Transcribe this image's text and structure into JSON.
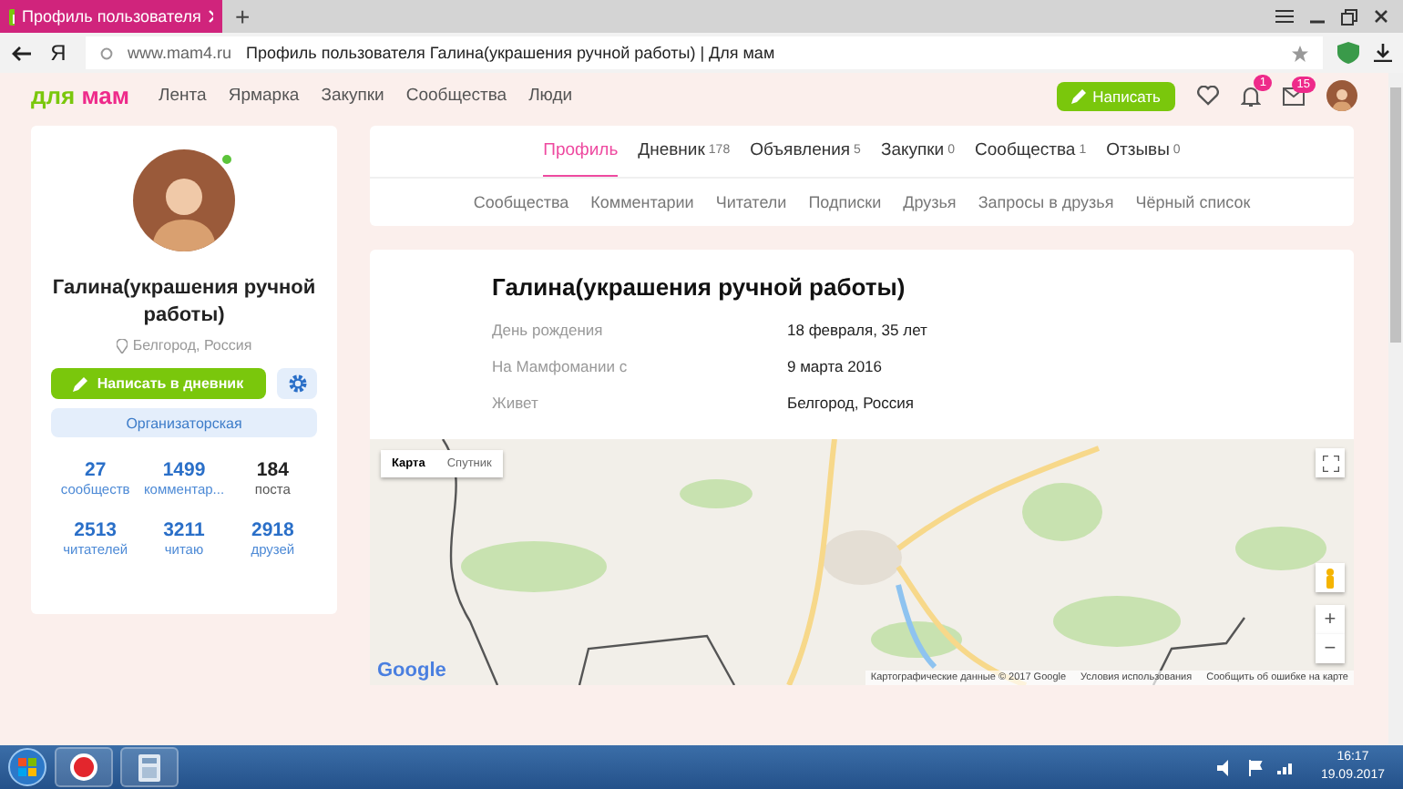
{
  "browser": {
    "tab_title": "Профиль пользователя",
    "new_tab": "+",
    "yandex_key": "Я",
    "url": "www.mam4.ru",
    "page_title": "Профиль пользователя Галина(украшения ручной работы) | Для мам"
  },
  "header": {
    "logo": {
      "first": "для",
      "second": "мам"
    },
    "nav": [
      "Лента",
      "Ярмарка",
      "Закупки",
      "Сообщества",
      "Люди"
    ],
    "write_button": "Написать",
    "notifications": "1",
    "messages": "15"
  },
  "profile": {
    "online": true,
    "name": "Галина(украшения ручной работы)",
    "location": "Белгород, Россия",
    "diary_button": "Написать в дневник",
    "role": "Организаторская",
    "stats": [
      {
        "value": "27",
        "label": "сообществ",
        "kind": "link"
      },
      {
        "value": "1499",
        "label": "комментар...",
        "kind": "link"
      },
      {
        "value": "184",
        "label": "поста",
        "kind": "plain"
      },
      {
        "value": "2513",
        "label": "читателей",
        "kind": "link"
      },
      {
        "value": "3211",
        "label": "читаю",
        "kind": "link"
      },
      {
        "value": "2918",
        "label": "друзей",
        "kind": "link"
      }
    ]
  },
  "tabs": [
    {
      "label": "Профиль",
      "selected": true
    },
    {
      "label": "Дневник",
      "count": "178",
      "selected": false
    },
    {
      "label": "Объявления",
      "count": "5",
      "selected": false
    },
    {
      "label": "Закупки",
      "count": "0",
      "selected": false
    },
    {
      "label": "Сообщества",
      "count": "1",
      "selected": false
    },
    {
      "label": "Отзывы",
      "count": "0",
      "selected": false
    }
  ],
  "subtabs": [
    "Сообщества",
    "Комментарии",
    "Читатели",
    "Подписки",
    "Друзья",
    "Запросы в друзья",
    "Чёрный список"
  ],
  "info": {
    "title": "Галина(украшения ручной работы)",
    "rows": [
      {
        "label": "День рождения",
        "value": "18 февраля, 35 лет"
      },
      {
        "label": "На Мамфомании с",
        "value": "9 марта 2016"
      },
      {
        "label": "Живет",
        "value": "Белгород, Россия"
      }
    ]
  },
  "map": {
    "types": [
      {
        "label": "Карта",
        "selected": true
      },
      {
        "label": "Спутник",
        "selected": false
      }
    ],
    "zoom_in": "+",
    "zoom_out": "−",
    "logo": "Google",
    "attribution": [
      "Картографические данные © 2017 Google",
      "Условия использования",
      "Сообщить об ошибке на карте"
    ]
  },
  "taskbar": {
    "time": "16:17",
    "date": "19.09.2017"
  }
}
